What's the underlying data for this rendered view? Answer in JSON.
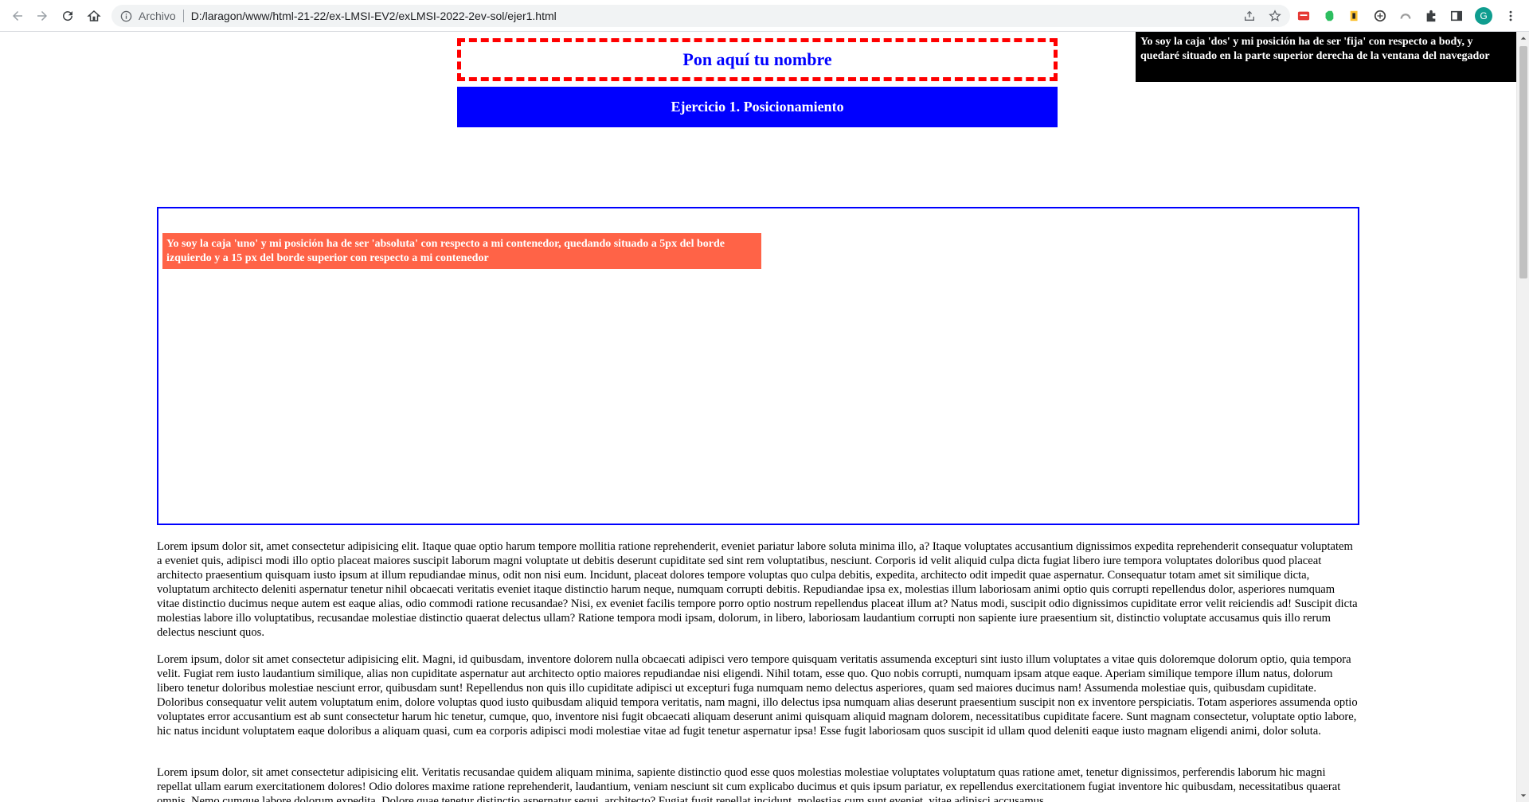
{
  "browser": {
    "scheme_label": "Archivo",
    "url": "D:/laragon/www/html-21-22/ex-LMSI-EV2/exLMSI-2022-2ev-sol/ejer1.html",
    "avatar_letter": "G",
    "icons": [
      "back-icon",
      "forward-icon",
      "reload-icon",
      "home-icon",
      "info-icon",
      "share-icon",
      "star-icon",
      "extension-red-icon",
      "evernote-icon",
      "extension-yellow-icon",
      "extension-grey-icon",
      "extension-arc-icon",
      "puzzle-icon",
      "sidepanel-icon",
      "kebab-menu-icon"
    ]
  },
  "page": {
    "name_placeholder": "Pon aquí tu nombre",
    "header_title": "Ejercicio 1. Posicionamiento",
    "caja_dos": "Yo soy la caja 'dos' y mi posición ha de ser 'fija' con respecto a body, y quedaré situado en la parte superior derecha de la ventana del navegador",
    "caja_uno": "Yo soy la caja 'uno' y mi posición ha de ser 'absoluta' con respecto a mi contenedor, quedando situado a 5px del borde izquierdo y a 15 px del borde superior con respecto a mi contenedor",
    "paragraphs": [
      "Lorem ipsum dolor sit, amet consectetur adipisicing elit. Itaque quae optio harum tempore mollitia ratione reprehenderit, eveniet pariatur labore soluta minima illo, a? Itaque voluptates accusantium dignissimos expedita reprehenderit consequatur voluptatem a eveniet quis, adipisci modi illo optio placeat maiores suscipit laborum magni voluptate ut debitis deserunt cupiditate sed sint rem voluptatibus, nesciunt. Corporis id velit aliquid culpa dicta fugiat libero iure tempora voluptates doloribus quod placeat architecto praesentium quisquam iusto ipsum at illum repudiandae minus, odit non nisi eum. Incidunt, placeat dolores tempore voluptas quo culpa debitis, expedita, architecto odit impedit quae aspernatur. Consequatur totam amet sit similique dicta, voluptatum architecto deleniti aspernatur tenetur nihil obcaecati veritatis eveniet itaque distinctio harum neque, numquam corrupti debitis. Repudiandae ipsa ex, molestias illum laboriosam animi optio quis corrupti repellendus dolor, asperiores numquam vitae distinctio ducimus neque autem est eaque alias, odio commodi ratione recusandae? Nisi, ex eveniet facilis tempore porro optio nostrum repellendus placeat illum at? Natus modi, suscipit odio dignissimos cupiditate error velit reiciendis ad! Suscipit dicta molestias labore illo voluptatibus, recusandae molestiae distinctio quaerat delectus ullam? Ratione tempora modi ipsam, dolorum, in libero, laboriosam laudantium corrupti non sapiente iure praesentium sit, distinctio voluptate accusamus quis illo rerum delectus nesciunt quos.",
      "Lorem ipsum, dolor sit amet consectetur adipisicing elit. Magni, id quibusdam, inventore dolorem nulla obcaecati adipisci vero tempore quisquam veritatis assumenda excepturi sint iusto illum voluptates a vitae quis doloremque dolorum optio, quia tempora velit. Fugiat rem iusto laudantium similique, alias non cupiditate aspernatur aut architecto optio maiores repudiandae nisi eligendi. Nihil totam, esse quo. Quo nobis corrupti, numquam ipsam atque eaque. Aperiam similique tempore illum natus, dolorum libero tenetur doloribus molestiae nesciunt error, quibusdam sunt! Repellendus non quis illo cupiditate adipisci ut excepturi fuga numquam nemo delectus asperiores, quam sed maiores ducimus nam! Assumenda molestiae quis, quibusdam cupiditate. Doloribus consequatur velit autem voluptatum enim, dolore voluptas quod iusto quibusdam aliquid tempora veritatis, nam magni, illo delectus ipsa numquam alias deserunt praesentium suscipit non ex inventore perspiciatis. Totam asperiores assumenda optio voluptates error accusantium est ab sunt consectetur harum hic tenetur, cumque, quo, inventore nisi fugit obcaecati aliquam deserunt animi quisquam aliquid magnam dolorem, necessitatibus cupiditate facere. Sunt magnam consectetur, voluptate optio labore, hic natus incidunt voluptatem eaque doloribus a aliquam quasi, cum ea corporis adipisci modi molestiae vitae ad fugit tenetur aspernatur ipsa! Esse fugit laboriosam quos suscipit id ullam quod deleniti eaque iusto magnam eligendi animi, dolor soluta.",
      "Lorem ipsum dolor, sit amet consectetur adipisicing elit. Veritatis recusandae quidem aliquam minima, sapiente distinctio quod esse quos molestias molestiae voluptates voluptatum quas ratione amet, tenetur dignissimos, perferendis laborum hic magni repellat ullam earum exercitationem dolores! Odio dolores maxime ratione reprehenderit, laudantium, veniam nesciunt sit cum explicabo ducimus et quis ipsum pariatur, ex repellendus exercitationem fugiat inventore hic quibusdam, necessitatibus quaerat omnis. Nemo cumque labore dolorum expedita. Dolore quae tenetur distinctio aspernatur sequi, architecto? Fugiat fugit repellat incidunt, molestias cum sunt eveniet, vitae adipisci accusamus."
    ]
  },
  "colors": {
    "name_border": "#ff0000",
    "name_text": "#0000ff",
    "header_bg": "#0000ff",
    "caja_dos_bg": "#000000",
    "caja_uno_bg": "#ff6347",
    "container_border": "#0000ff"
  }
}
